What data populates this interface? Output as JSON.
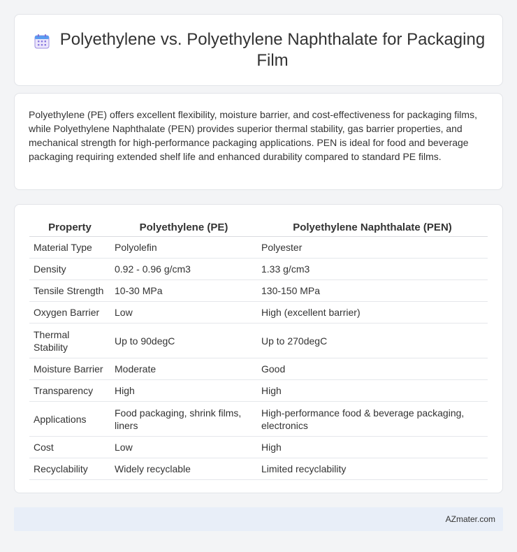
{
  "header": {
    "icon": "calendar-icon",
    "title": "Polyethylene vs. Polyethylene Naphthalate for Packaging Film"
  },
  "summary": {
    "text": "Polyethylene (PE) offers excellent flexibility, moisture barrier, and cost-effectiveness for packaging films, while Polyethylene Naphthalate (PEN) provides superior thermal stability, gas barrier properties, and mechanical strength for high-performance packaging applications. PEN is ideal for food and beverage packaging requiring extended shelf life and enhanced durability compared to standard PE films."
  },
  "table": {
    "headers": [
      "Property",
      "Polyethylene (PE)",
      "Polyethylene Naphthalate (PEN)"
    ],
    "rows": [
      [
        "Material Type",
        "Polyolefin",
        "Polyester"
      ],
      [
        "Density",
        "0.92 - 0.96 g/cm3",
        "1.33 g/cm3"
      ],
      [
        "Tensile Strength",
        "10-30 MPa",
        "130-150 MPa"
      ],
      [
        "Oxygen Barrier",
        "Low",
        "High (excellent barrier)"
      ],
      [
        "Thermal Stability",
        "Up to 90degC",
        "Up to 270degC"
      ],
      [
        "Moisture Barrier",
        "Moderate",
        "Good"
      ],
      [
        "Transparency",
        "High",
        "High"
      ],
      [
        "Applications",
        "Food packaging, shrink films, liners",
        "High-performance food & beverage packaging, electronics"
      ],
      [
        "Cost",
        "Low",
        "High"
      ],
      [
        "Recyclability",
        "Widely recyclable",
        "Limited recyclability"
      ]
    ]
  },
  "footer": {
    "brand": "AZmater.com"
  }
}
